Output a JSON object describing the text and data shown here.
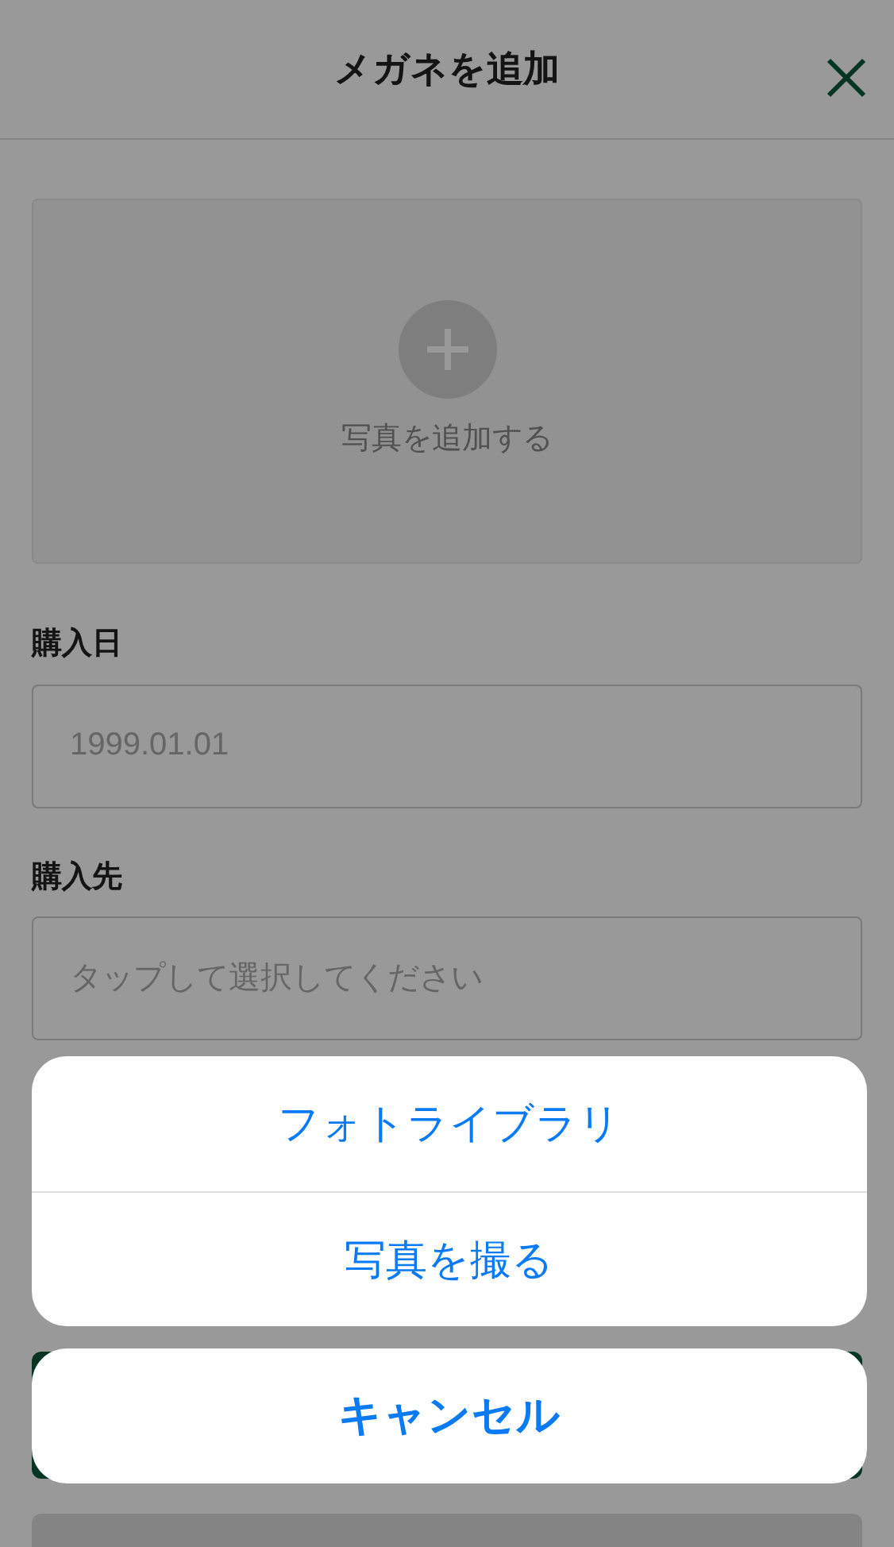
{
  "header": {
    "title": "メガネを追加"
  },
  "photo_picker": {
    "label": "写真を追加する"
  },
  "fields": [
    {
      "label": "購入日",
      "placeholder": "1999.01.01"
    },
    {
      "label": "購入先",
      "placeholder": "タップして選択してください"
    }
  ],
  "action_sheet": {
    "options": [
      "フォトライブラリ",
      "写真を撮る"
    ],
    "cancel": "キャンセル"
  }
}
